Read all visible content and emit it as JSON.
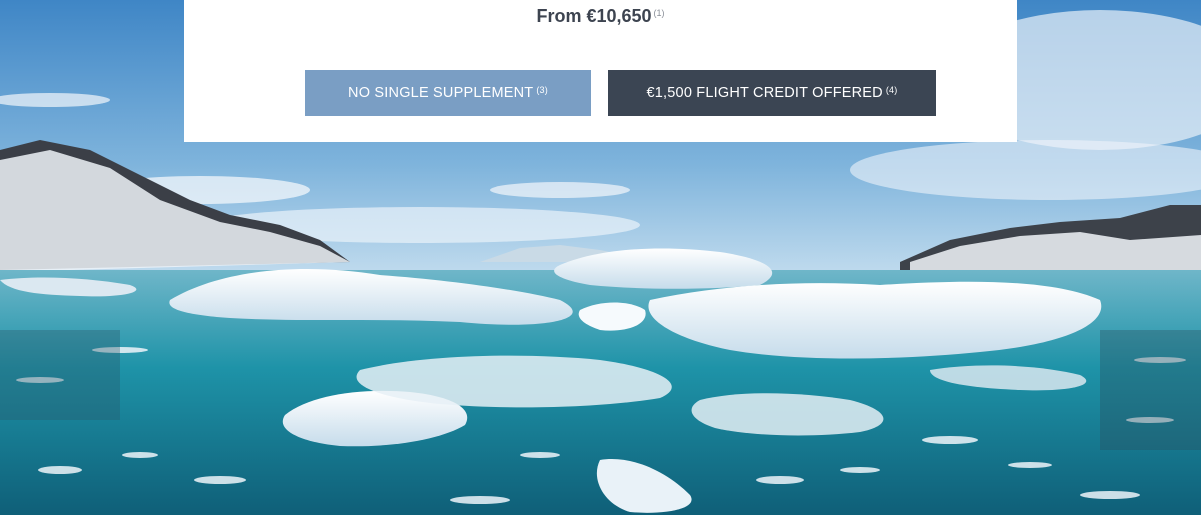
{
  "offer": {
    "price_text": "From €10,650",
    "price_note": "(1)"
  },
  "buttons": [
    {
      "label": "NO SINGLE SUPPLEMENT",
      "note": "(3)",
      "color": "#7a9ec4"
    },
    {
      "label": "€1,500 FLIGHT CREDIT OFFERED",
      "note": "(4)",
      "color": "#3b4553"
    }
  ],
  "colors": {
    "card_bg": "#ffffff",
    "price_text": "#3d4450",
    "sky": "#4d8fc9",
    "water": "#1b8ea3"
  }
}
